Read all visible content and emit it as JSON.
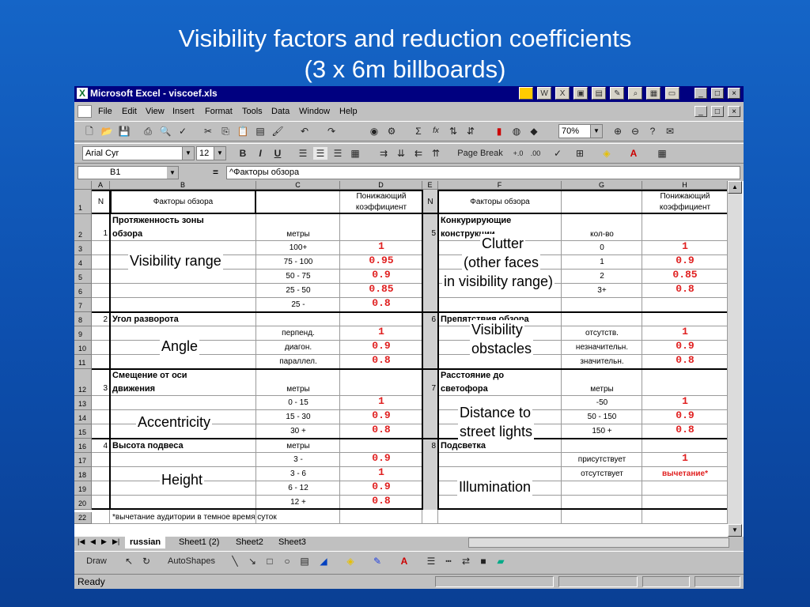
{
  "slide": {
    "title_line1": "Visibility factors and reduction coefficients",
    "title_line2": "(3 x 6m billboards)"
  },
  "window": {
    "title": "Microsoft Excel - viscoef.xls",
    "controls": [
      "_",
      "□",
      "×"
    ]
  },
  "menu": [
    "File",
    "Edit",
    "View",
    "Insert",
    "Format",
    "Tools",
    "Data",
    "Window",
    "Help"
  ],
  "toolbar": {
    "zoom": "70%",
    "sigma": "Σ",
    "fx": "fx"
  },
  "format_bar": {
    "font": "Arial Cyr",
    "size": "12",
    "bold": "B",
    "italic": "I",
    "underline": "U",
    "page_break": "Page Break"
  },
  "formula_bar": {
    "name_box": "B1",
    "equals": "=",
    "content": "^Факторы обзора"
  },
  "columns": [
    "A",
    "B",
    "C",
    "D",
    "E",
    "F",
    "G",
    "H"
  ],
  "rows": [
    {
      "num": "1"
    },
    {
      "num": "2"
    },
    {
      "num": "3"
    },
    {
      "num": "4"
    },
    {
      "num": "5"
    },
    {
      "num": "6"
    },
    {
      "num": "7"
    },
    {
      "num": "8"
    },
    {
      "num": "9"
    },
    {
      "num": "10"
    },
    {
      "num": "11"
    },
    {
      "num": "12"
    },
    {
      "num": "13"
    },
    {
      "num": "14"
    },
    {
      "num": "15"
    },
    {
      "num": "16"
    },
    {
      "num": "17"
    },
    {
      "num": "18"
    },
    {
      "num": "19"
    },
    {
      "num": "20"
    },
    {
      "num": "22"
    }
  ],
  "header": {
    "n": "N",
    "factors": "Факторы обзора",
    "coef_line1": "Понижающий",
    "coef_line2": "коэффициент"
  },
  "left_blocks": [
    {
      "num": "1",
      "title_line1": "Протяженность зоны",
      "title_line2": "обзора",
      "unit": "метры",
      "rows": [
        {
          "range": "100+",
          "coef": "1"
        },
        {
          "range": "75 - 100",
          "coef": "0.95"
        },
        {
          "range": "50 - 75",
          "coef": "0.9"
        },
        {
          "range": "25 - 50",
          "coef": "0.85"
        },
        {
          "range": "25 -",
          "coef": "0.8"
        }
      ]
    },
    {
      "num": "2",
      "title_line1": "Угол разворота",
      "rows": [
        {
          "range": "перпенд.",
          "coef": "1"
        },
        {
          "range": "диагон.",
          "coef": "0.9"
        },
        {
          "range": "параллел.",
          "coef": "0.8"
        }
      ]
    },
    {
      "num": "3",
      "title_line1": "Смещение от оси",
      "title_line2": "движения",
      "unit": "метры",
      "rows": [
        {
          "range": "0 - 15",
          "coef": "1"
        },
        {
          "range": "15 - 30",
          "coef": "0.9"
        },
        {
          "range": "30 +",
          "coef": "0.8"
        }
      ]
    },
    {
      "num": "4",
      "title_line1": "Высота подвеса",
      "unit": "метры",
      "rows": [
        {
          "range": "3 -",
          "coef": "0.9"
        },
        {
          "range": "3 - 6",
          "coef": "1"
        },
        {
          "range": "6 - 12",
          "coef": "0.9"
        },
        {
          "range": "12 +",
          "coef": "0.8"
        }
      ]
    }
  ],
  "right_blocks": [
    {
      "num": "5",
      "title_line1": "Конкурирующие",
      "title_line2": "конструкции",
      "unit": "кол-во",
      "rows": [
        {
          "range": "0",
          "coef": "1"
        },
        {
          "range": "1",
          "coef": "0.9"
        },
        {
          "range": "2",
          "coef": "0.85"
        },
        {
          "range": "3+",
          "coef": "0.8"
        }
      ]
    },
    {
      "num": "6",
      "title_line1": "Препятствия обзора",
      "rows": [
        {
          "range": "отсутств.",
          "coef": "1"
        },
        {
          "range": "незначительн.",
          "coef": "0.9"
        },
        {
          "range": "значительн.",
          "coef": "0.8"
        }
      ]
    },
    {
      "num": "7",
      "title_line1": "Расстояние до",
      "title_line2": "светофора",
      "unit": "метры",
      "rows": [
        {
          "range": "-50",
          "coef": "1"
        },
        {
          "range": "50 - 150",
          "coef": "0.9"
        },
        {
          "range": "150 +",
          "coef": "0.8"
        }
      ]
    },
    {
      "num": "8",
      "title_line1": "Подсветка",
      "rows": [
        {
          "range": "присутствует",
          "coef": "1"
        },
        {
          "range": "отсутствует",
          "coef": "вычетание*"
        }
      ]
    }
  ],
  "footnote": "*вычетание аудитории в темное время суток",
  "annotations": {
    "visibility_range": "Visibility range",
    "angle": "Angle",
    "accentricity": "Accentricity",
    "height": "Height",
    "clutter_line1": "Clutter",
    "clutter_line2": "(other faces",
    "clutter_line3": "in visibility range)",
    "obstacles_line1": "Visibility",
    "obstacles_line2": "obstacles",
    "distance_line1": "Distance to",
    "distance_line2": "street lights",
    "illumination": "Illumination"
  },
  "sheet_tabs": [
    "russian",
    "Sheet1 (2)",
    "Sheet2",
    "Sheet3"
  ],
  "draw_toolbar": {
    "draw": "Draw",
    "autoshapes": "AutoShapes"
  },
  "status": "Ready",
  "colors": {
    "slide_bg": "#1565c7",
    "titlebar": "#000080",
    "coef_red": "#e02020"
  }
}
